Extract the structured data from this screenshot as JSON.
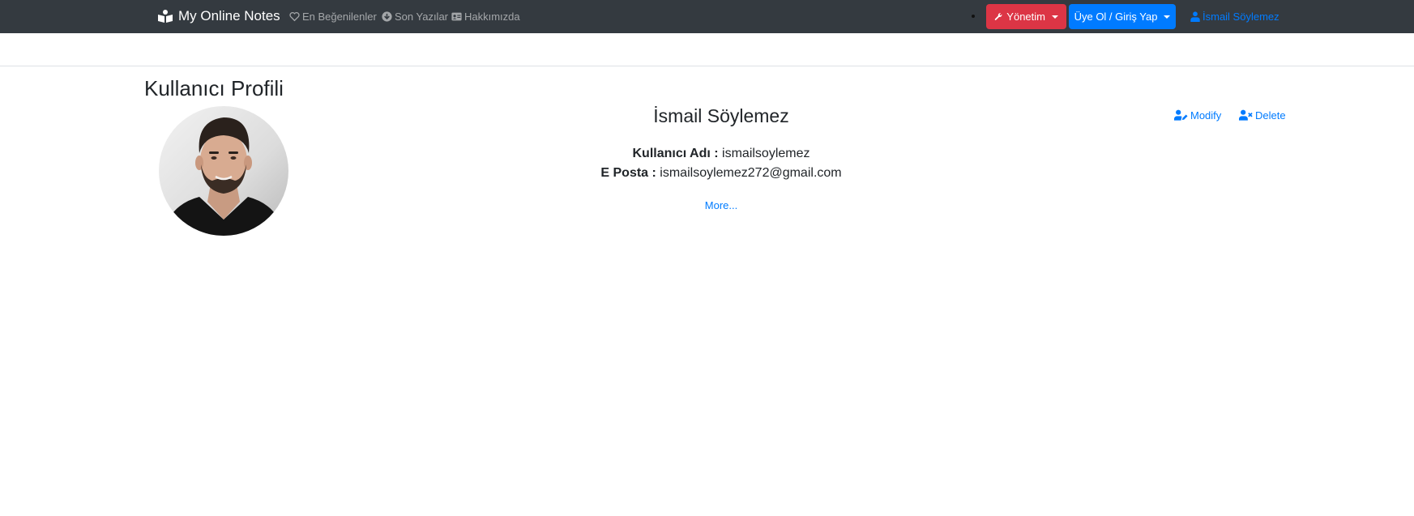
{
  "navbar": {
    "brand": "My Online Notes",
    "brand_icon": "reader-icon",
    "links": [
      {
        "label": "En Beğenilenler",
        "icon": "heart-icon"
      },
      {
        "label": "Son Yazılar",
        "icon": "arrow-circle-down-icon"
      },
      {
        "label": "Hakkımızda",
        "icon": "id-card-icon"
      }
    ],
    "admin_button": {
      "label": "Yönetim",
      "icon": "wrench-icon",
      "color": "#dc3545"
    },
    "auth_button": {
      "label": "Üye Ol / Giriş Yap",
      "color": "#007bff"
    },
    "user_link": {
      "label": "İsmail Söylemez",
      "icon": "user-icon"
    }
  },
  "page": {
    "title": "Kullanıcı Profili"
  },
  "profile": {
    "name": "İsmail Söylemez",
    "username_label": "Kullanıcı Adı :",
    "username": "ismailsoylemez",
    "email_label": "E Posta :",
    "email": "ismailsoylemez272@gmail.com",
    "more": "More..."
  },
  "actions": {
    "modify": "Modify",
    "delete": "Delete"
  },
  "colors": {
    "navbar_bg": "#343a40",
    "link": "#007bff",
    "danger": "#dc3545",
    "primary": "#007bff"
  }
}
